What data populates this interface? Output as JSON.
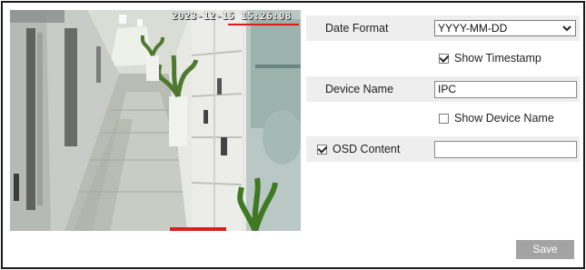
{
  "preview": {
    "timestamp": "2023-12-15 15:26:08"
  },
  "settings": {
    "date_format": {
      "label": "Date Format",
      "value": "YYYY-MM-DD"
    },
    "show_timestamp": {
      "label": "Show Timestamp",
      "checked": true
    },
    "device_name": {
      "label": "Device Name",
      "value": "IPC"
    },
    "show_device_name": {
      "label": "Show Device Name",
      "checked": false
    },
    "osd_content": {
      "label": "OSD Content",
      "checked": true,
      "value": ""
    }
  },
  "actions": {
    "save_label": "Save"
  },
  "colors": {
    "save_button": "#a3a3a3",
    "row_shade": "#eeeeee",
    "osd_underline": "#e01818"
  }
}
